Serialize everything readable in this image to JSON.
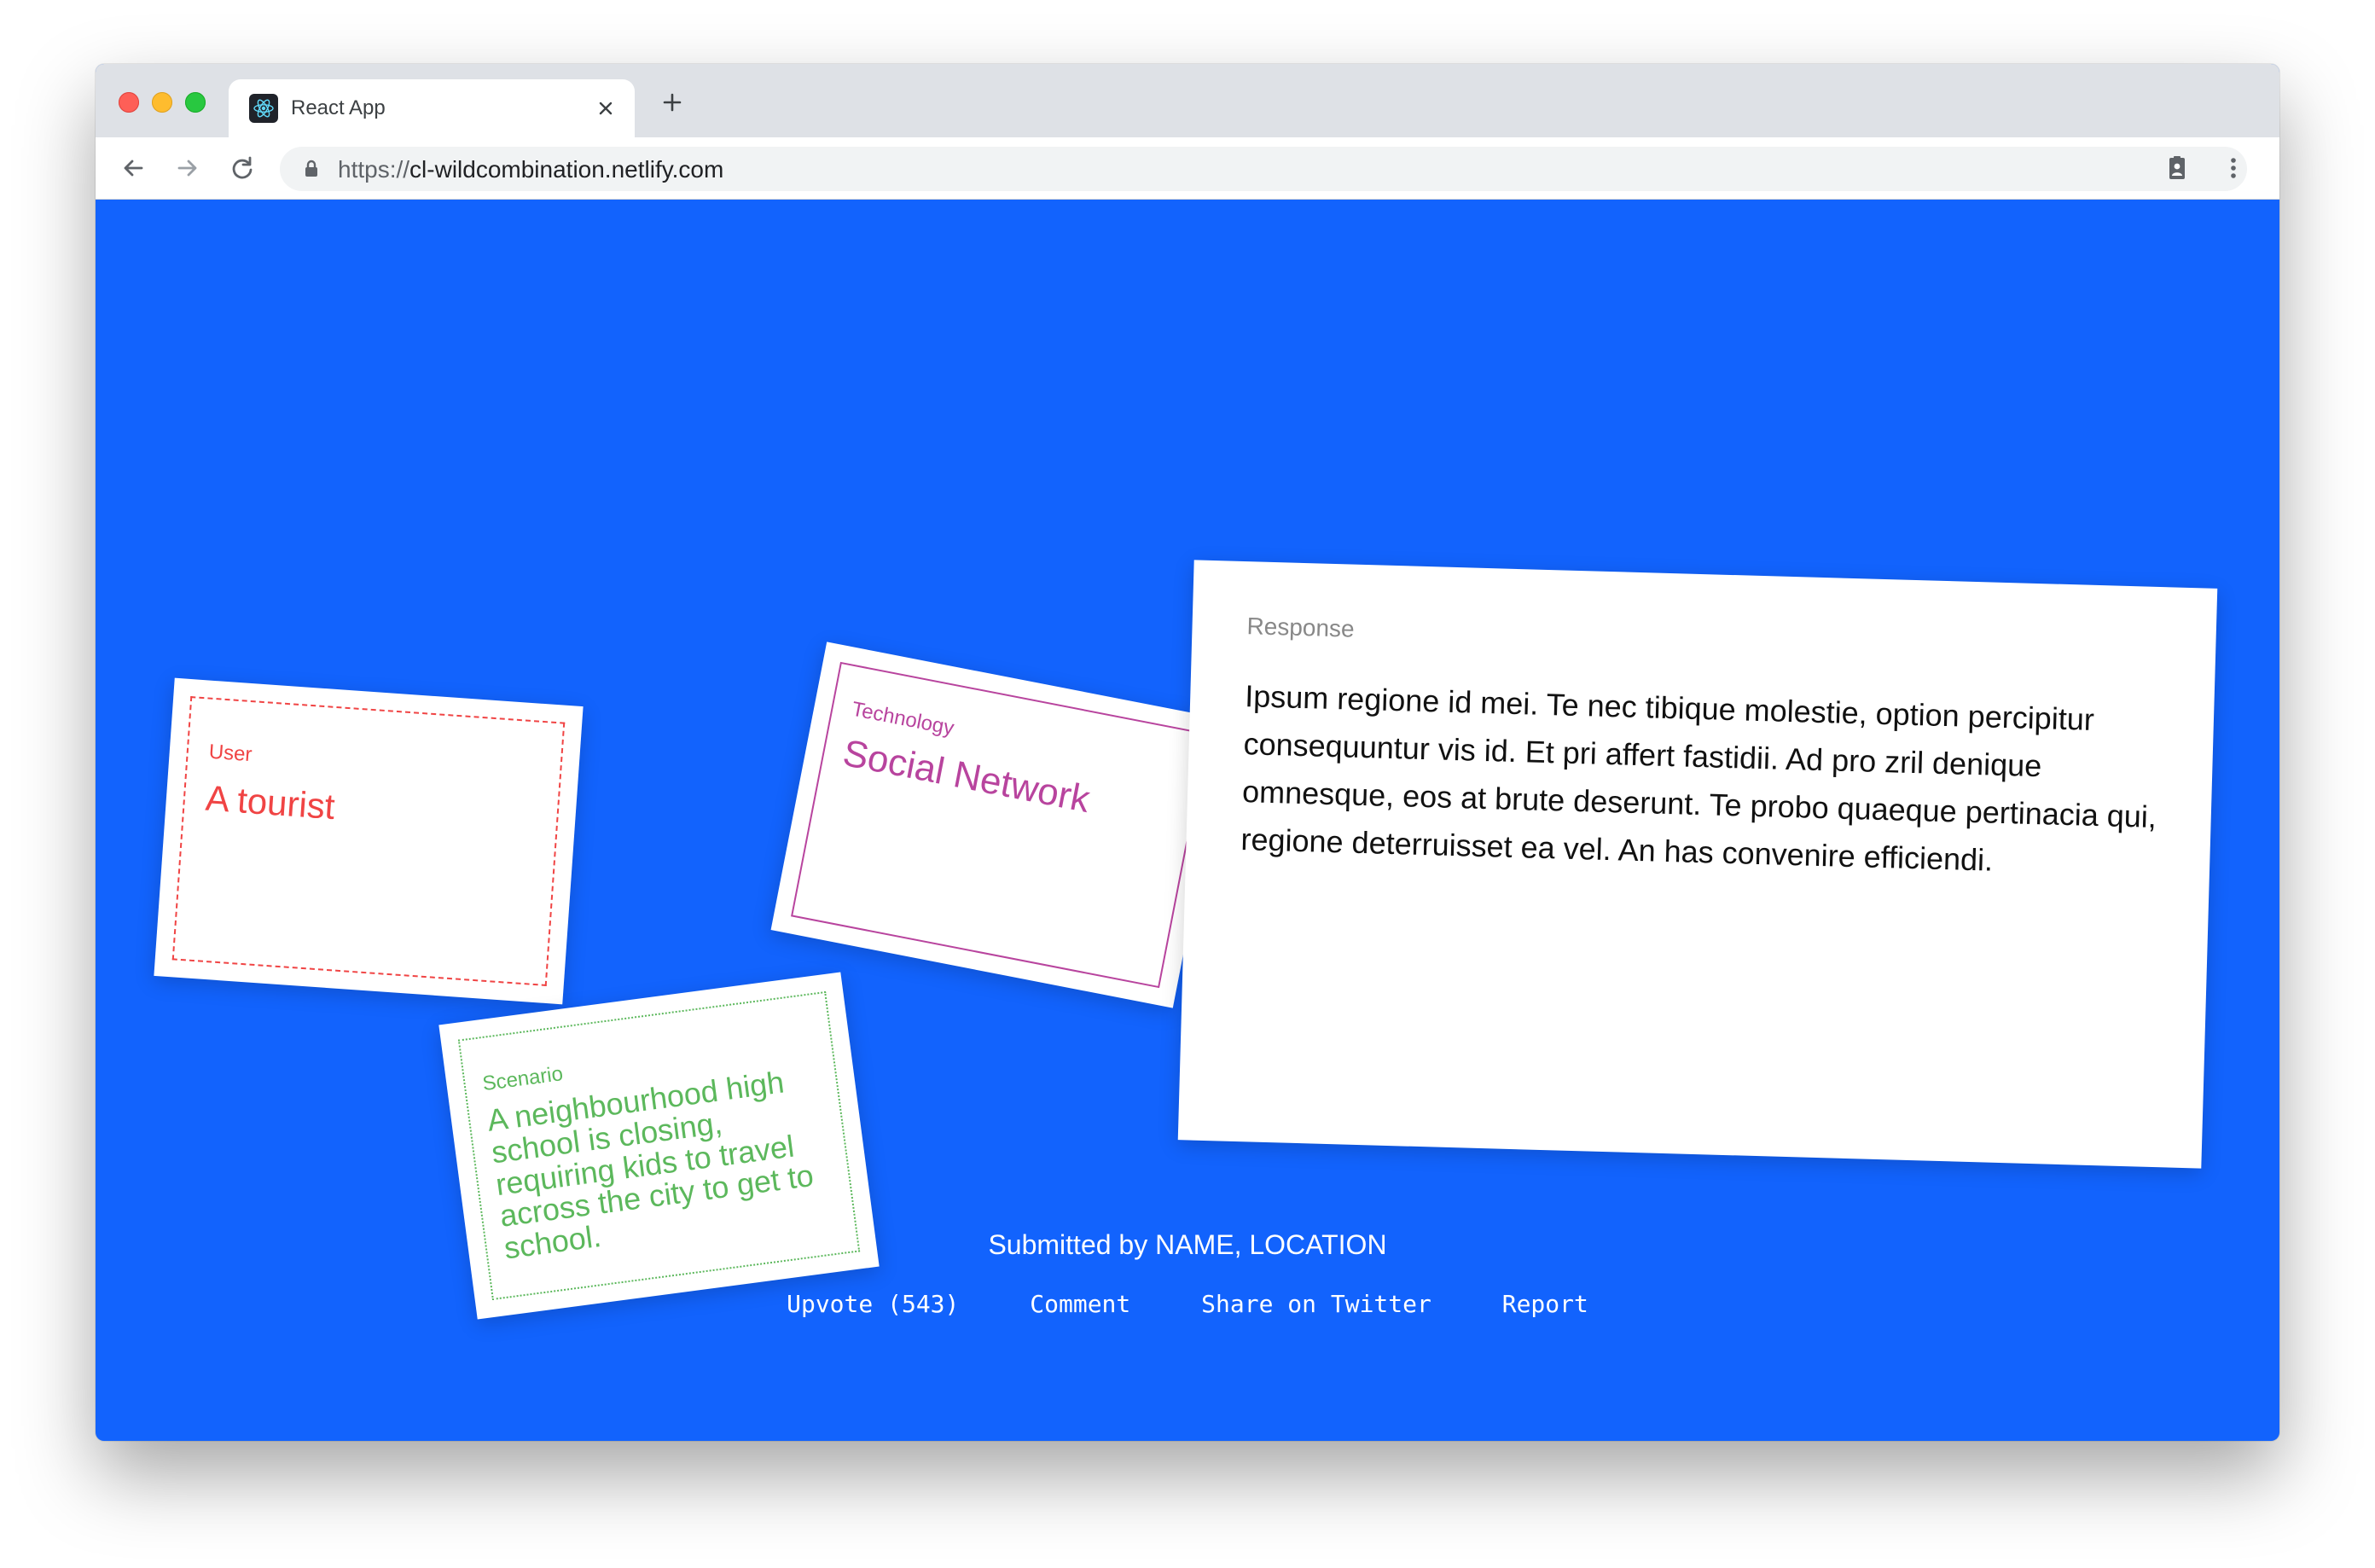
{
  "browser": {
    "tab_title": "React App",
    "url_scheme": "https://",
    "url_host": "cl-wildcombination.netlify.com"
  },
  "cards": {
    "user": {
      "label": "User",
      "value": "A tourist",
      "color": "#f04444"
    },
    "scenario": {
      "label": "Scenario",
      "value": "A neighbourhood high school is closing, requiring kids to travel across the city to get to school.",
      "color": "#5cb85c"
    },
    "technology": {
      "label": "Technology",
      "value": "Social Network",
      "color": "#b8449e"
    },
    "response": {
      "label": "Response",
      "body": "Ipsum regione id mei. Te nec tibique molestie, option percipitur consequuntur vis id. Et pri affert fastidii. Ad pro zril denique omnesque, eos at brute deserunt. Te probo quaeque pertinacia qui, regione deterruisset ea vel. An has convenire efficiendi."
    }
  },
  "footer": {
    "submitted": "Submitted by NAME, LOCATION",
    "upvote": "Upvote (543)",
    "comment": "Comment",
    "share": "Share on Twitter",
    "report": "Report"
  },
  "colors": {
    "background": "#1263fd"
  },
  "icons": [
    "react-favicon-icon",
    "close-icon",
    "plus-icon",
    "back-arrow-icon",
    "forward-arrow-icon",
    "reload-icon",
    "lock-icon",
    "badge-extension-icon",
    "more-vert-icon"
  ]
}
